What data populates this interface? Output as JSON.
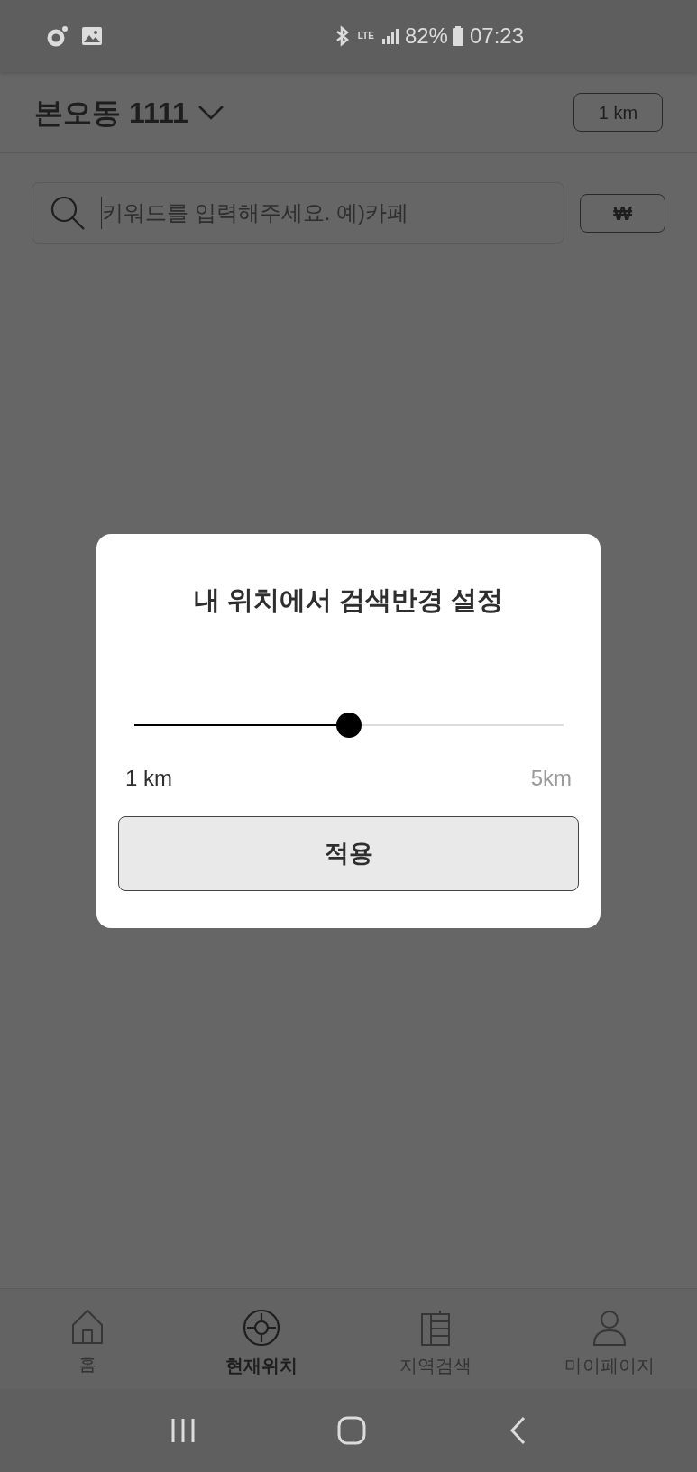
{
  "status_bar": {
    "network": "LTE",
    "battery": "82%",
    "time": "07:23"
  },
  "header": {
    "location": "본오동 1111",
    "radius_button": "1 km"
  },
  "search": {
    "placeholder": "키워드를 입력해주세요. 예)카페",
    "currency_button": "₩"
  },
  "dialog": {
    "title": "내 위치에서 검색반경 설정",
    "slider": {
      "level": 0.5
    },
    "min_label": "1 km",
    "max_label": "5km",
    "apply_button": "적용"
  },
  "bottom_nav": [
    {
      "label": "홈",
      "selected": false
    },
    {
      "label": "현재위치",
      "selected": true
    },
    {
      "label": "지역검색",
      "selected": false
    },
    {
      "label": "마이페이지",
      "selected": false
    }
  ]
}
